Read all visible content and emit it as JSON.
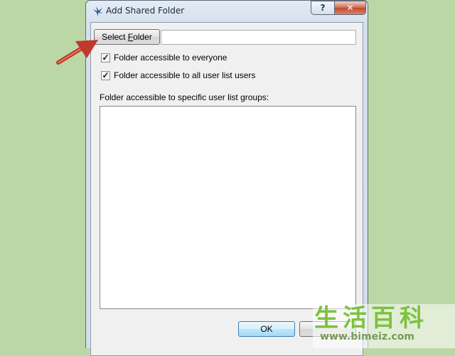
{
  "window": {
    "title": "Add Shared Folder",
    "help_label": "?",
    "close_label": "✕"
  },
  "form": {
    "select_folder_label_pre": "Select ",
    "select_folder_label_accel": "F",
    "select_folder_label_post": "older",
    "folder_path_value": "",
    "checkboxes": [
      {
        "label": "Folder accessible to everyone",
        "checked": true,
        "mark": "✓"
      },
      {
        "label": "Folder accessible to all user list users",
        "checked": true,
        "mark": "✓"
      }
    ],
    "groups_label": "Folder accessible to specific user list groups:",
    "groups": []
  },
  "buttons": {
    "ok_label": "OK",
    "cancel_label": ""
  },
  "watermark": {
    "characters": "生活百科",
    "url": "www.bimeiz.com"
  },
  "colors": {
    "background": "#bcd7a6",
    "annotation_arrow": "#c0392b",
    "close_button": "#c75a3d"
  }
}
